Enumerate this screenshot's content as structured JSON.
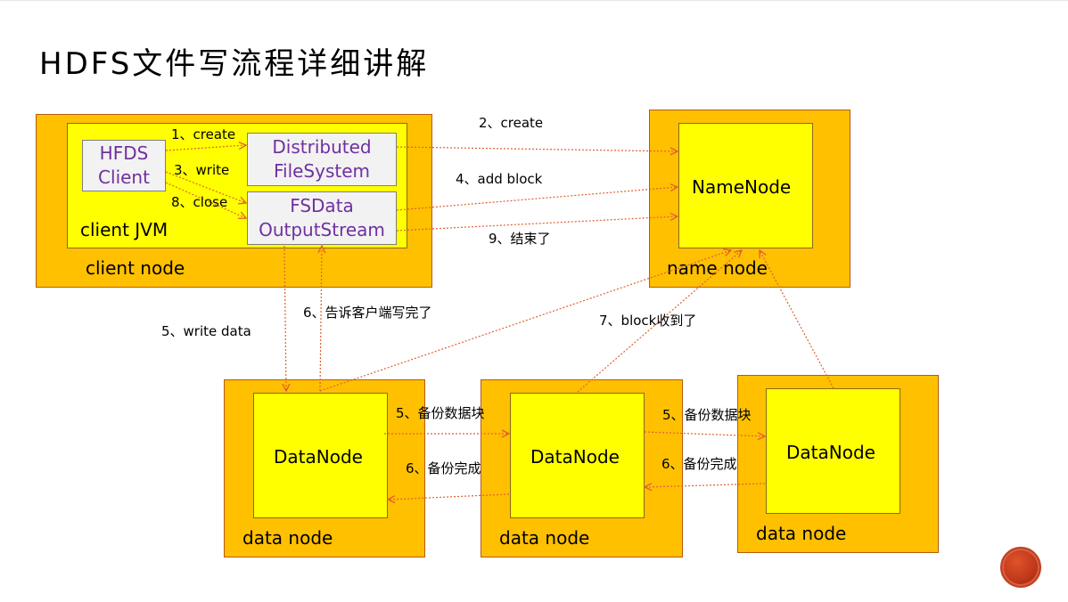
{
  "title": "HDFS文件写流程详细讲解",
  "client_node": {
    "label": "client node",
    "jvm_label": "client JVM",
    "hfds_client": "HFDS\nClient",
    "distributed_fs": "Distributed\nFileSystem",
    "fsdata_stream": "FSData\nOutputStream"
  },
  "name_node": {
    "label": "name node",
    "inner": "NameNode"
  },
  "data_nodes": [
    {
      "label": "data node",
      "inner": "DataNode"
    },
    {
      "label": "data node",
      "inner": "DataNode"
    },
    {
      "label": "data node",
      "inner": "DataNode"
    }
  ],
  "arrows": {
    "create1": "1、create",
    "write3": "3、write",
    "close8": "8、close",
    "create2": "2、create",
    "add_block4": "4、add block",
    "done9": "9、结束了",
    "write_data5": "5、write data",
    "tell_client6": "6、告诉客户端写完了",
    "block_received7": "7、block收到了",
    "backup_a5": "5、备份数据块",
    "backup_a6": "6、备份完成",
    "backup_b5": "5、备份数据块",
    "backup_b6": "6、备份完成"
  },
  "colors": {
    "node_outer": "#ffc000",
    "node_inner": "#ffff00",
    "component_text": "#7030a0",
    "arrow": "#e06030"
  }
}
